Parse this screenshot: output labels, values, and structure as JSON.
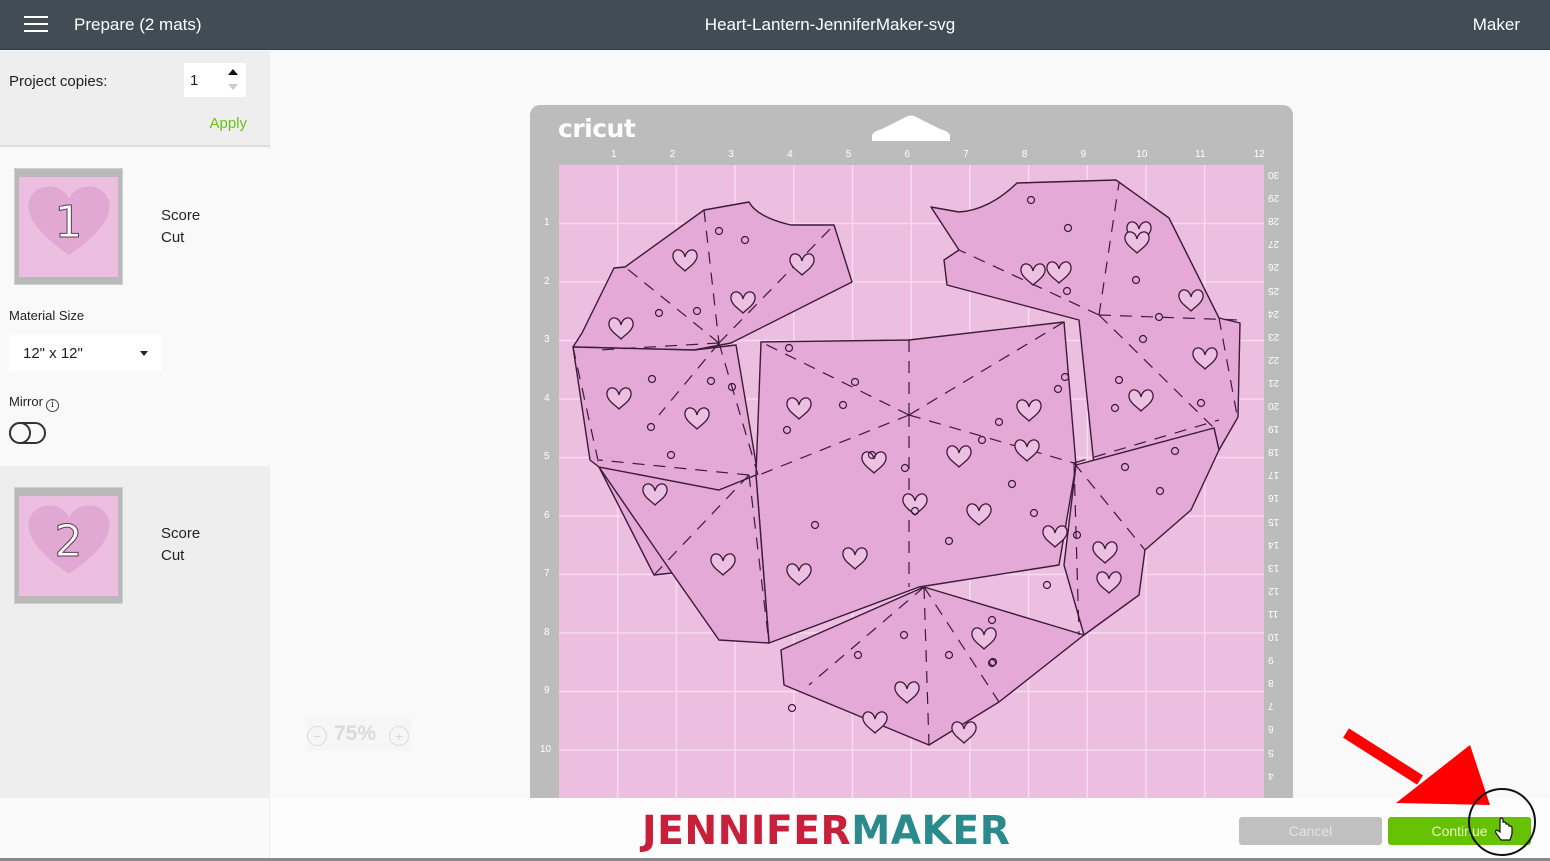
{
  "header": {
    "menu_icon": "hamburger-menu-icon",
    "title_left": "Prepare (2 mats)",
    "project_name": "Heart-Lantern-JenniferMaker-svg",
    "machine": "Maker"
  },
  "sidebar": {
    "project_copies_label": "Project copies:",
    "project_copies_value": "1",
    "apply_label": "Apply",
    "mats": [
      {
        "number": "1",
        "operations": [
          "Score",
          "Cut"
        ],
        "material_size_label": "Material Size",
        "material_size_value": "12\" x 12\"",
        "mirror_label": "Mirror",
        "mirror_on": false
      },
      {
        "number": "2",
        "operations": [
          "Score",
          "Cut"
        ]
      }
    ]
  },
  "mat_preview": {
    "brand": "cricut",
    "top_ruler": [
      "1",
      "2",
      "3",
      "4",
      "5",
      "6",
      "7",
      "8",
      "9",
      "10",
      "11",
      "12"
    ],
    "left_ruler": [
      "1",
      "2",
      "3",
      "4",
      "5",
      "6",
      "7",
      "8",
      "9",
      "10"
    ],
    "right_ruler": [
      "30",
      "29",
      "28",
      "27",
      "26",
      "25",
      "24",
      "23",
      "22",
      "21",
      "20",
      "19",
      "18",
      "17",
      "16",
      "15",
      "14",
      "13",
      "12",
      "11",
      "10",
      "9",
      "8",
      "7",
      "6",
      "5",
      "4"
    ],
    "zoom_level": "75%",
    "colors": {
      "mat_frame": "#bcbcbc",
      "mat_surface": "#ecbee0",
      "design_fill": "#e4a9d6",
      "design_stroke": "#3d1a3a"
    }
  },
  "footer": {
    "logo_part1": "JENNIFER",
    "logo_part2": "MAKER",
    "cancel_label": "Cancel",
    "continue_label": "Continue",
    "colors": {
      "continue": "#66c100",
      "cancel": "#c0c0c0",
      "logo_red": "#c8203a",
      "logo_teal": "#2a8a8c"
    }
  },
  "annotation": {
    "arrow_color": "#ff0000",
    "highlight": "cursor-on-continue"
  }
}
